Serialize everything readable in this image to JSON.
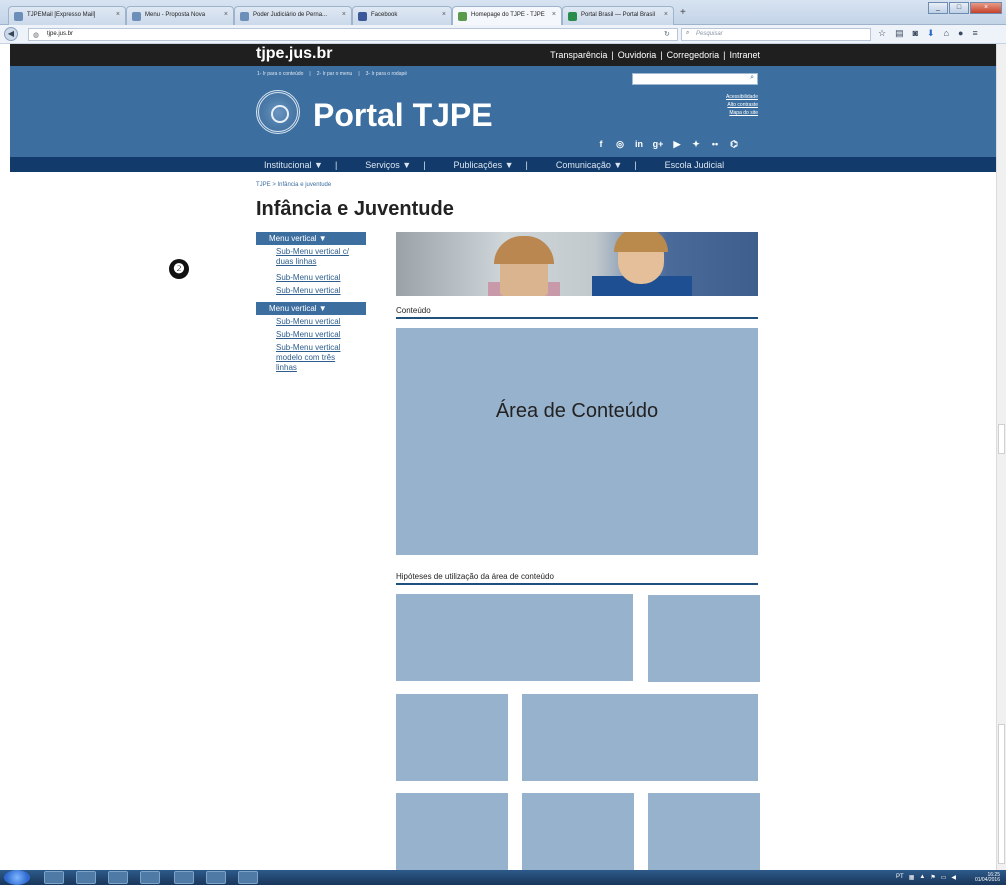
{
  "browser": {
    "tabs": [
      {
        "label": "TJPEMail [Expresso Mail]",
        "active": false
      },
      {
        "label": "Menu - Proposta Nova",
        "active": false
      },
      {
        "label": "Poder Judiciário de Perna...",
        "active": false
      },
      {
        "label": "Facebook",
        "active": false
      },
      {
        "label": "Homepage do TJPE - TJPE",
        "active": true
      },
      {
        "label": "Portal Brasil — Portal Brasil",
        "active": false
      }
    ],
    "url": "tjpe.jus.br",
    "search_placeholder": "Pesquisar"
  },
  "site": {
    "name": "tjpe.jus.br",
    "top_links": [
      "Transparência",
      "Ouvidoria",
      "Corregedoria",
      "Intranet"
    ],
    "skip_links": [
      "1- Ir para o conteúdo",
      "2- Ir par o menu",
      "3- Ir para o rodapé"
    ],
    "accessibility_links": [
      "Acessibilidade",
      "Alto contraste",
      "Mapa do site"
    ],
    "portal_title": "Portal TJPE",
    "social_icons": [
      "facebook-icon",
      "instagram-icon",
      "linkedin-icon",
      "googleplus-icon",
      "youtube-icon",
      "twitter-icon",
      "flickr-icon",
      "rss-icon"
    ],
    "main_menu": [
      "Institucional ▼",
      "Serviços ▼",
      "Publicações ▼",
      "Comunicação ▼",
      "Escola Judicial"
    ],
    "breadcrumb": "TJPE > Infância e juventude",
    "page_title": "Infância e Juventude",
    "step_number": "❷",
    "sidenav": [
      {
        "header": "Menu vertical ▼",
        "items": [
          "Sub-Menu vertical c/ duas linhas",
          "Sub-Menu vertical",
          "Sub-Menu vertical"
        ]
      },
      {
        "header": "Menu vertical ▼",
        "items": [
          "Sub-Menu vertical",
          "Sub-Menu vertical",
          "Sub-Menu vertical modelo com três linhas"
        ]
      }
    ],
    "content_heading": "Conteúdo",
    "content_area_label": "Área de Conteúdo",
    "hypotheses_heading": "Hipóteses de utilização da área de conteúdo"
  },
  "taskbar": {
    "time": "16:25",
    "date": "01/04/2016",
    "lang": "PT"
  },
  "colors": {
    "header_blue": "#3c6e9f",
    "menu_navy": "#123a6a",
    "placeholder_blue": "#97b2cd"
  }
}
